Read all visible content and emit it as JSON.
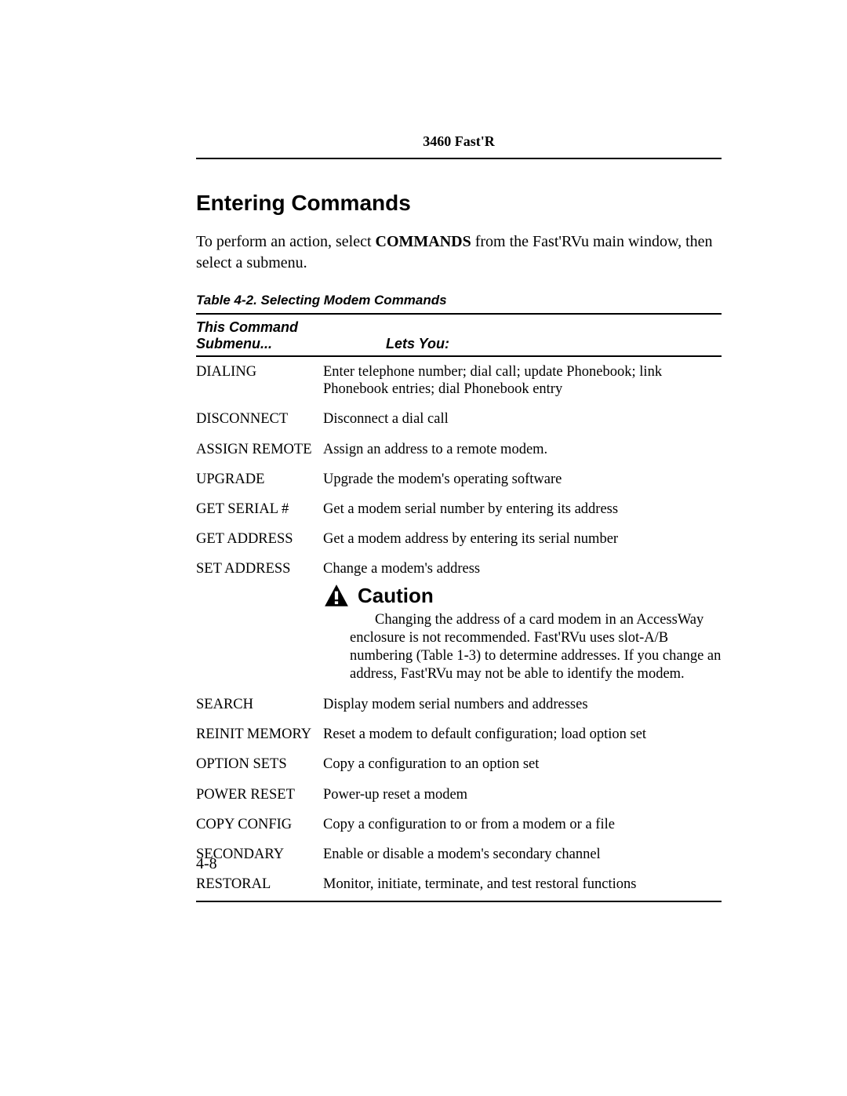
{
  "header": {
    "product": "3460 Fast'R"
  },
  "section_title": "Entering Commands",
  "intro": {
    "pre": "To perform an action, select ",
    "bold": "COMMANDS",
    "post": " from the Fast'RVu main window, then select a submenu."
  },
  "table": {
    "caption": "Table 4-2. Selecting Modem Commands",
    "head": {
      "col1_line1": "This Command",
      "col1_line2": "Submenu...",
      "col2": "Lets You:"
    },
    "rows": [
      {
        "cmd": "DIALING",
        "desc": "Enter telephone number; dial call; update Phonebook; link Phonebook entries; dial Phonebook entry"
      },
      {
        "cmd": "DISCONNECT",
        "desc": "Disconnect a dial call"
      },
      {
        "cmd": "ASSIGN REMOTE",
        "desc": "Assign an address to a remote modem."
      },
      {
        "cmd": "UPGRADE",
        "desc": "Upgrade the modem's operating software"
      },
      {
        "cmd": "GET SERIAL #",
        "desc": "Get a modem serial number by entering its address"
      },
      {
        "cmd": "GET ADDRESS",
        "desc": "Get a modem address by entering its serial number"
      },
      {
        "cmd": "SET ADDRESS",
        "desc": "Change a modem's address",
        "has_caution": true
      },
      {
        "cmd": "SEARCH",
        "desc": "Display modem serial numbers and addresses"
      },
      {
        "cmd": "REINIT MEMORY",
        "desc": "Reset a modem to default configuration; load option set"
      },
      {
        "cmd": "OPTION SETS",
        "desc": "Copy a configuration to an option set"
      },
      {
        "cmd": "POWER RESET",
        "desc": "Power-up reset a modem"
      },
      {
        "cmd": "COPY CONFIG",
        "desc": "Copy a configuration to or from a modem or a file"
      },
      {
        "cmd": "SECONDARY",
        "desc": "Enable or disable a modem's secondary channel"
      },
      {
        "cmd": "RESTORAL",
        "desc": "Monitor, initiate, terminate, and test restoral functions"
      }
    ]
  },
  "caution": {
    "label": "Caution",
    "text": "Changing the address of a card modem in an AccessWay enclosure is not recommended. Fast'RVu uses slot-A/B numbering (Table 1-3) to determine addresses. If you change an address, Fast'RVu may not be able to identify the modem."
  },
  "page_number": "4-8"
}
